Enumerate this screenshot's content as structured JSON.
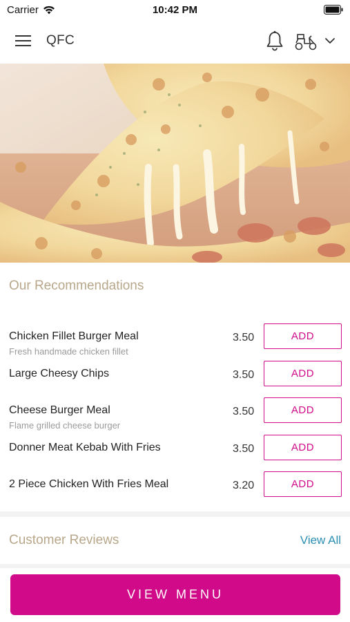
{
  "status_bar": {
    "carrier": "Carrier",
    "time": "10:42 PM"
  },
  "nav": {
    "title": "QFC"
  },
  "recommendations": {
    "title": "Our Recommendations",
    "items": [
      {
        "name": "Chicken Fillet Burger Meal",
        "description": "Fresh handmade chicken fillet",
        "price": "3.50",
        "button": "ADD"
      },
      {
        "name": "Large Cheesy Chips",
        "description": "",
        "price": "3.50",
        "button": "ADD"
      },
      {
        "name": "Cheese Burger Meal",
        "description": "Flame grilled cheese burger",
        "price": "3.50",
        "button": "ADD"
      },
      {
        "name": "Donner Meat Kebab With Fries",
        "description": "",
        "price": "3.50",
        "button": "ADD"
      },
      {
        "name": "2 Piece Chicken With Fries Meal",
        "description": "",
        "price": "3.20",
        "button": "ADD"
      }
    ]
  },
  "reviews": {
    "title": "Customer Reviews",
    "view_all": "View All"
  },
  "footer": {
    "view_menu": "VIEW MENU"
  },
  "colors": {
    "accent": "#d10a8a",
    "section_title": "#b8a78a",
    "link": "#2a8fb0"
  },
  "icons": [
    "wifi-icon",
    "battery-icon",
    "menu-icon",
    "bell-icon",
    "delivery-scooter-icon",
    "chevron-down-icon"
  ]
}
